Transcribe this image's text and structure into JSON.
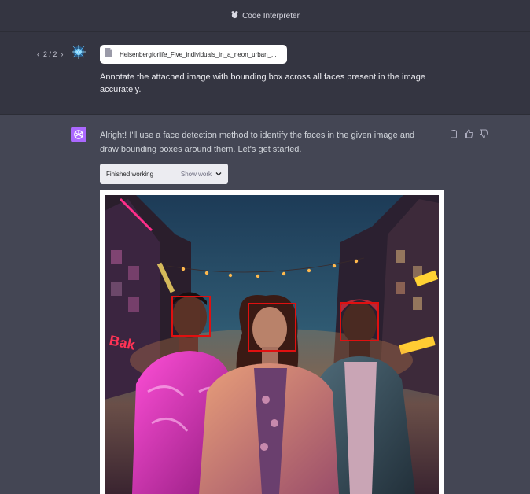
{
  "header": {
    "title": "Code Interpreter"
  },
  "user_turn": {
    "pager": {
      "prev": "‹",
      "label": "2 / 2",
      "next": "›"
    },
    "file_name": "Heisenbergforlife_Five_individuals_in_a_neon_urban_...",
    "message": "Annotate the attached image with bounding box across all faces present in the image accurately."
  },
  "assistant_turn": {
    "message": "Alright! I'll use a face detection method to identify the faces in the given image and draw bounding boxes around them. Let's get started.",
    "status": {
      "label": "Finished working",
      "toggle": "Show work"
    },
    "actions": [
      "copy-icon",
      "thumbs-up-icon",
      "thumbs-down-icon"
    ],
    "result_image": {
      "faces_detected": 3
    }
  },
  "colors": {
    "background": "#444654",
    "header": "#343541",
    "assistant_avatar": "#ab68ff",
    "bounding_box": "#e01010"
  }
}
